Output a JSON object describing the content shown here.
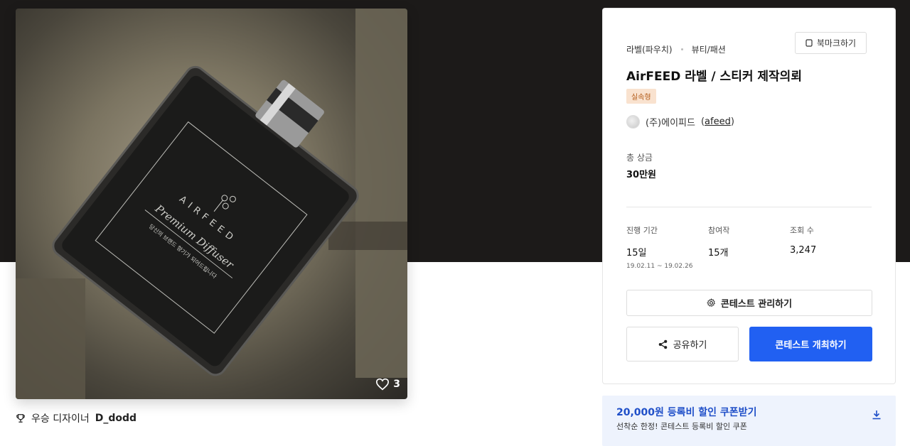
{
  "image": {
    "like_count": "3",
    "label_lines": [
      "AIRFEED",
      "Premium Diffuser",
      "당신의 브랜드 향기가 되어드립니다"
    ]
  },
  "winner": {
    "label": "우승 디자이너",
    "name": "D_dodd"
  },
  "contest": {
    "category_main": "라벨(파우치)",
    "category_sub": "뷰티/패션",
    "bookmark_label": "북마크하기",
    "title": "AirFEED 라벨 / 스티커 제작의뢰",
    "type_badge": "실속형",
    "host_name": "(주)에이피드",
    "host_handle": "afeed",
    "prize_label": "총 상금",
    "prize_value": "30만원",
    "stats": {
      "duration_label": "진행 기간",
      "duration_value": "15일",
      "duration_range": "19.02.11 ~ 19.02.26",
      "entries_label": "참여작",
      "entries_value": "15개",
      "views_label": "조회 수",
      "views_value": "3,247"
    },
    "manage_label": "콘테스트 관리하기",
    "share_label": "공유하기",
    "host_contest_label": "콘테스트 개최하기"
  },
  "coupon": {
    "title": "20,000원 등록비 할인 쿠폰받기",
    "subtitle": "선착순 한정! 콘테스트 등록비 할인 쿠폰"
  },
  "colors": {
    "hero_bg": "#1c1a19",
    "primary": "#2160f2",
    "coupon_bg": "#eef3fd",
    "coupon_text": "#1f4fc8",
    "badge_bg": "#f9e2cf",
    "badge_text": "#b25a18"
  },
  "icons": [
    "heart-icon",
    "trophy-icon",
    "bookmark-icon",
    "gear-icon",
    "share-icon",
    "download-icon"
  ]
}
